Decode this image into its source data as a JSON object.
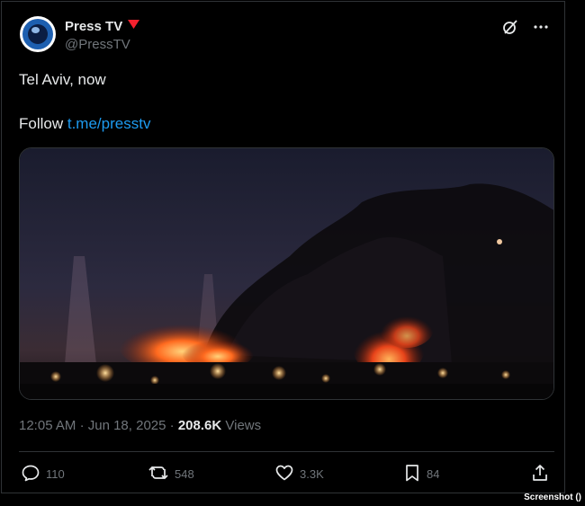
{
  "account": {
    "name": "Press TV",
    "handle": "@PressTV"
  },
  "tweet": {
    "text": "Tel Aviv, now",
    "follow_prefix": "Follow",
    "follow_link": "t.me/presstv"
  },
  "meta": {
    "time": "12:05 AM",
    "separator": "·",
    "date": "Jun 18, 2025",
    "views_count": "208.6K",
    "views_label": "Views"
  },
  "actions": {
    "replies": "110",
    "reposts": "548",
    "likes": "3.3K",
    "bookmarks": "84"
  },
  "credit": "Screenshot ()",
  "colors": {
    "background": "#000000",
    "text": "#e7e9ea",
    "muted": "#71767b",
    "link": "#1d9bf0",
    "affiliation_badge": "#f4212e"
  },
  "icons": [
    "reply-icon",
    "repost-icon",
    "like-icon",
    "bookmark-icon",
    "share-icon",
    "grok-icon",
    "more-icon",
    "affiliation-icon"
  ]
}
